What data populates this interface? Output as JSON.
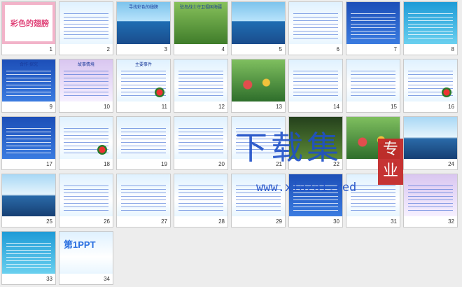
{
  "slides": [
    {
      "n": "1",
      "title": "彩色的翅膀",
      "bg": "frame"
    },
    {
      "n": "2",
      "title": "",
      "bg": "sky"
    },
    {
      "n": "3",
      "title": "寻找彩色的翅膀",
      "bg": "ocean"
    },
    {
      "n": "4",
      "title": "驻岛战士守卫祖国海疆",
      "bg": "green"
    },
    {
      "n": "5",
      "title": "",
      "bg": "ocean"
    },
    {
      "n": "6",
      "title": "",
      "bg": "sky"
    },
    {
      "n": "7",
      "title": "",
      "bg": "blue"
    },
    {
      "n": "8",
      "title": "",
      "bg": "teal"
    },
    {
      "n": "9",
      "title": "合作·探究",
      "bg": "blue"
    },
    {
      "n": "10",
      "title": "故事情境",
      "bg": "purple"
    },
    {
      "n": "11",
      "title": "主要事件",
      "bg": "sky"
    },
    {
      "n": "12",
      "title": "",
      "bg": "sky"
    },
    {
      "n": "13",
      "title": "",
      "bg": "flower"
    },
    {
      "n": "14",
      "title": "",
      "bg": "sky"
    },
    {
      "n": "15",
      "title": "",
      "bg": "sky"
    },
    {
      "n": "16",
      "title": "",
      "bg": "sky"
    },
    {
      "n": "17",
      "title": "",
      "bg": "blue"
    },
    {
      "n": "18",
      "title": "",
      "bg": "sky"
    },
    {
      "n": "19",
      "title": "",
      "bg": "sky"
    },
    {
      "n": "20",
      "title": "",
      "bg": "sky"
    },
    {
      "n": "21",
      "title": "",
      "bg": "sky"
    },
    {
      "n": "22",
      "title": "",
      "bg": "dark"
    },
    {
      "n": "23",
      "title": "",
      "bg": "flower"
    },
    {
      "n": "24",
      "title": "",
      "bg": "island"
    },
    {
      "n": "25",
      "title": "",
      "bg": "island"
    },
    {
      "n": "26",
      "title": "",
      "bg": "sky"
    },
    {
      "n": "27",
      "title": "",
      "bg": "sky"
    },
    {
      "n": "28",
      "title": "",
      "bg": "sky"
    },
    {
      "n": "29",
      "title": "",
      "bg": "sky"
    },
    {
      "n": "30",
      "title": "",
      "bg": "blue"
    },
    {
      "n": "31",
      "title": "",
      "bg": "sky"
    },
    {
      "n": "32",
      "title": "",
      "bg": "purple"
    },
    {
      "n": "33",
      "title": "",
      "bg": "teal"
    },
    {
      "n": "34",
      "title": "第1PPT",
      "bg": "sky"
    }
  ],
  "watermark": {
    "cn": "下载集",
    "url": "www.xiazai.red",
    "badge": "专业"
  }
}
